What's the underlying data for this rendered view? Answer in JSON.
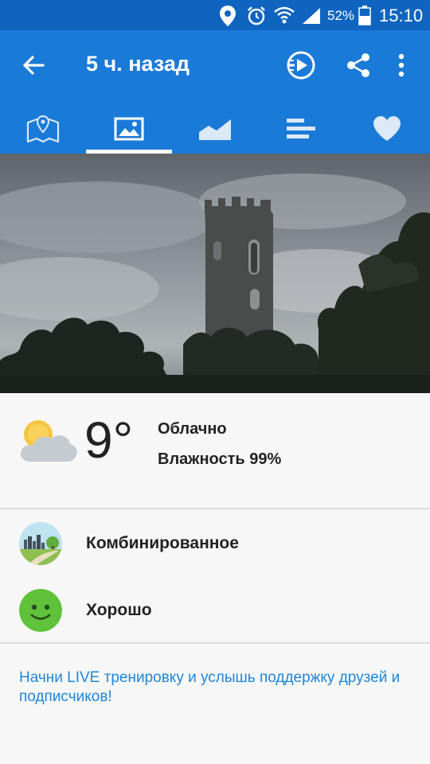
{
  "status_bar": {
    "battery_percent": "52%",
    "time": "15:10"
  },
  "app_bar": {
    "title": "5 ч. назад",
    "icons": [
      "back-arrow-icon",
      "play-video-icon",
      "share-icon",
      "more-vert-icon"
    ],
    "tabs": [
      {
        "name": "map-icon",
        "active": false
      },
      {
        "name": "photo-icon",
        "active": true
      },
      {
        "name": "chart-icon",
        "active": false
      },
      {
        "name": "list-icon",
        "active": false
      },
      {
        "name": "heart-icon",
        "active": false
      }
    ]
  },
  "weather": {
    "temperature": "9°",
    "condition": "Облачно",
    "humidity": "Влажность 99%",
    "icon": "partly-cloudy-icon"
  },
  "rows": [
    {
      "label": "Комбинированное",
      "icon": "terrain-mixed-icon"
    },
    {
      "label": "Хорошо",
      "icon": "smiley-good-icon"
    }
  ],
  "live_prompt": "Начни LIVE тренировку и услышь поддержку друзей и подписчиков!",
  "colors": {
    "status_bar": "#0f64c0",
    "app_bar": "#1a7ad8",
    "link": "#1f86d8",
    "good_green": "#5fc23a"
  }
}
